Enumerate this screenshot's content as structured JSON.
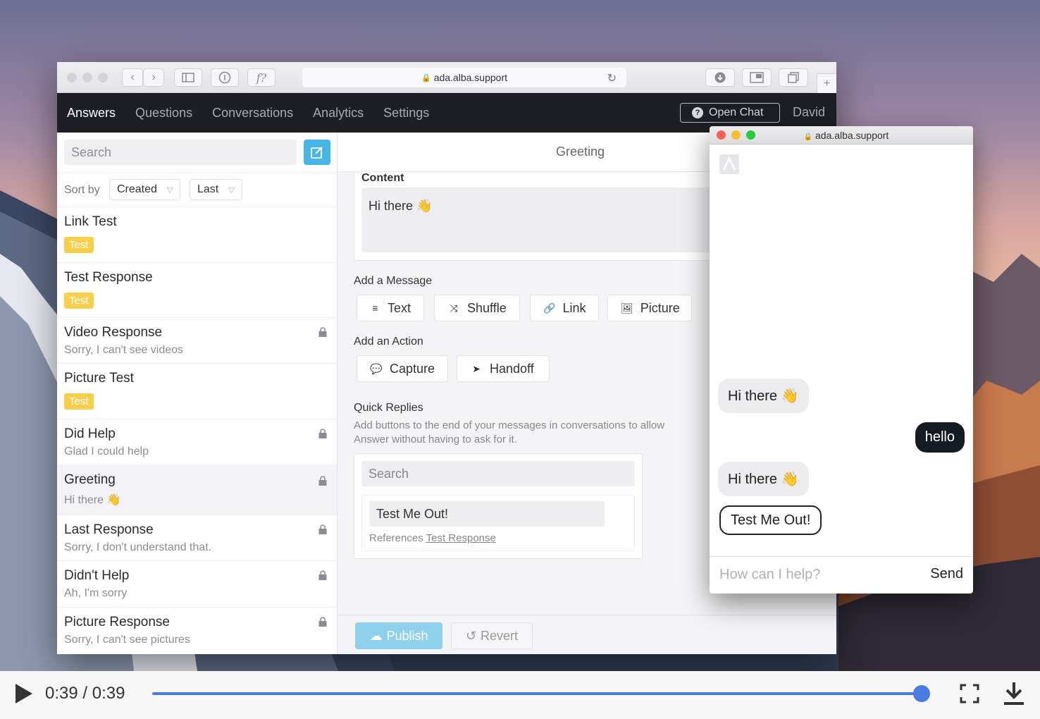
{
  "browser": {
    "url": "ada.alba.support"
  },
  "nav": {
    "items": [
      "Answers",
      "Questions",
      "Conversations",
      "Analytics",
      "Settings"
    ],
    "active_index": 0,
    "open_chat_label": "Open Chat",
    "user": "David"
  },
  "sidebar": {
    "search_placeholder": "Search",
    "sort_label": "Sort by",
    "sort_field": "Created",
    "sort_order": "Last",
    "items": [
      {
        "title": "Link Test",
        "badge": "Test",
        "sub": "",
        "locked": false
      },
      {
        "title": "Test Response",
        "badge": "Test",
        "sub": "",
        "locked": false
      },
      {
        "title": "Video Response",
        "badge": "",
        "sub": "Sorry, I can't see videos",
        "locked": true
      },
      {
        "title": "Picture Test",
        "badge": "Test",
        "sub": "",
        "locked": false
      },
      {
        "title": "Did Help",
        "badge": "",
        "sub": "Glad I could help",
        "locked": true
      },
      {
        "title": "Greeting",
        "badge": "",
        "sub": "Hi there 👋",
        "locked": true
      },
      {
        "title": "Last Response",
        "badge": "",
        "sub": "Sorry, I don't understand that.",
        "locked": true
      },
      {
        "title": "Didn't Help",
        "badge": "",
        "sub": "Ah, I'm sorry",
        "locked": true
      },
      {
        "title": "Picture Response",
        "badge": "",
        "sub": "Sorry, I can't see pictures",
        "locked": true
      }
    ],
    "selected_index": 5
  },
  "editor": {
    "title": "Greeting",
    "content_label": "Content",
    "content_text": "Hi there 👋",
    "add_message_label": "Add a Message",
    "message_buttons": [
      {
        "label": "Text",
        "icon": "≡"
      },
      {
        "label": "Shuffle",
        "icon": "⤨"
      },
      {
        "label": "Link",
        "icon": "🔗"
      },
      {
        "label": "Picture",
        "icon": "🖼"
      }
    ],
    "add_action_label": "Add an Action",
    "action_buttons": [
      {
        "label": "Capture",
        "icon": "💬"
      },
      {
        "label": "Handoff",
        "icon": "➤"
      }
    ],
    "quick_replies_label": "Quick Replies",
    "quick_replies_desc": "Add buttons to the end of your messages in conversations to allow",
    "quick_replies_desc2": "Answer without having to ask for it.",
    "qr_search_placeholder": "Search",
    "qr_item_label": "Test Me Out!",
    "qr_references_label": "References",
    "qr_references_link": "Test Response",
    "publish_label": "Publish",
    "revert_label": "Revert"
  },
  "chat": {
    "url": "ada.alba.support",
    "messages": [
      {
        "from": "bot",
        "text": "Hi there 👋"
      },
      {
        "from": "user",
        "text": "hello"
      },
      {
        "from": "bot",
        "text": "Hi there 👋"
      }
    ],
    "quick_reply": "Test Me Out!",
    "input_placeholder": "How can I help?",
    "send_label": "Send"
  },
  "video": {
    "time": "0:39 / 0:39",
    "progress": 1.0
  },
  "colors": {
    "accent": "#45b6e6",
    "badge": "#f8cf4a",
    "nav_bg": "#1e1f24",
    "progress": "#4a7be4"
  }
}
